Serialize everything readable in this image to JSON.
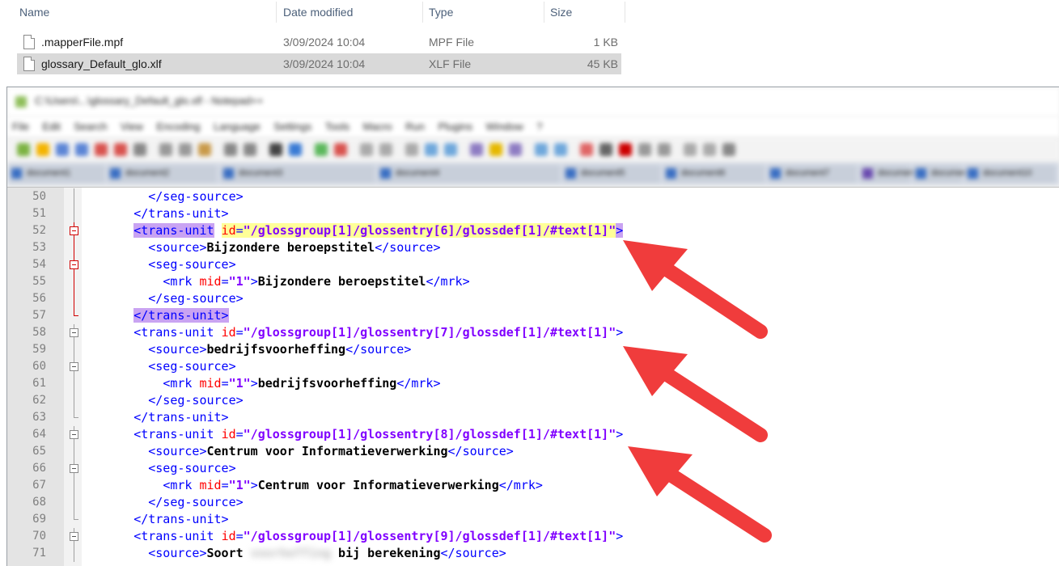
{
  "explorer": {
    "columns": [
      "Name",
      "Date modified",
      "Type",
      "Size"
    ],
    "files": [
      {
        "name": ".mapperFile.mpf",
        "date": "3/09/2024 10:04",
        "type": "MPF File",
        "size": "1 KB",
        "selected": false
      },
      {
        "name": "glossary_Default_glo.xlf",
        "date": "3/09/2024 10:04",
        "type": "XLF File",
        "size": "45 KB",
        "selected": true
      }
    ]
  },
  "notepad": {
    "title": "C:\\Users\\...\\glossary_Default_glo.xlf - Notepad++",
    "menu": [
      "File",
      "Edit",
      "Search",
      "View",
      "Encoding",
      "Language",
      "Settings",
      "Tools",
      "Macro",
      "Run",
      "Plugins",
      "Window",
      "?"
    ],
    "tabs": [
      "document1",
      "document2",
      "document3",
      "document4",
      "document5",
      "document6",
      "document7",
      "document8",
      "document9",
      "document10"
    ]
  },
  "editor": {
    "lines": [
      {
        "num": "50",
        "pre": "        ",
        "parts": [
          [
            "tag",
            "</seg-source>"
          ]
        ]
      },
      {
        "num": "51",
        "pre": "      ",
        "parts": [
          [
            "tag",
            "</trans-unit>"
          ]
        ]
      },
      {
        "num": "52",
        "pre": "      ",
        "parts": [
          [
            "tag hl-tag",
            "<trans-unit"
          ],
          [
            "plain",
            " "
          ],
          [
            "attr hl-attr",
            "id"
          ],
          [
            "tag hl-attr",
            "="
          ],
          [
            "val hl-attr",
            "\"/glossgroup[1]/glossentry[6]/glossdef[1]/#text[1]\""
          ],
          [
            "tag hl-tag",
            ">"
          ]
        ]
      },
      {
        "num": "53",
        "pre": "        ",
        "parts": [
          [
            "tag",
            "<source>"
          ],
          [
            "txt",
            "Bijzondere beroepstitel"
          ],
          [
            "tag",
            "</source>"
          ]
        ]
      },
      {
        "num": "54",
        "pre": "        ",
        "parts": [
          [
            "tag",
            "<seg-source>"
          ]
        ]
      },
      {
        "num": "55",
        "pre": "          ",
        "parts": [
          [
            "tag",
            "<mrk "
          ],
          [
            "attr",
            "mid"
          ],
          [
            "tag",
            "="
          ],
          [
            "val",
            "\"1\""
          ],
          [
            "tag",
            ">"
          ],
          [
            "txt",
            "Bijzondere beroepstitel"
          ],
          [
            "tag",
            "</mrk>"
          ]
        ]
      },
      {
        "num": "56",
        "pre": "        ",
        "parts": [
          [
            "tag",
            "</seg-source>"
          ]
        ]
      },
      {
        "num": "57",
        "pre": "      ",
        "parts": [
          [
            "tag hl-tag",
            "</trans-unit>"
          ]
        ]
      },
      {
        "num": "58",
        "pre": "      ",
        "parts": [
          [
            "tag",
            "<trans-unit "
          ],
          [
            "attr",
            "id"
          ],
          [
            "tag",
            "="
          ],
          [
            "val",
            "\"/glossgroup[1]/glossentry[7]/glossdef[1]/#text[1]\""
          ],
          [
            "tag",
            ">"
          ]
        ]
      },
      {
        "num": "59",
        "pre": "        ",
        "parts": [
          [
            "tag",
            "<source>"
          ],
          [
            "txt",
            "bedrijfsvoorheffing"
          ],
          [
            "tag",
            "</source>"
          ]
        ]
      },
      {
        "num": "60",
        "pre": "        ",
        "parts": [
          [
            "tag",
            "<seg-source>"
          ]
        ]
      },
      {
        "num": "61",
        "pre": "          ",
        "parts": [
          [
            "tag",
            "<mrk "
          ],
          [
            "attr",
            "mid"
          ],
          [
            "tag",
            "="
          ],
          [
            "val",
            "\"1\""
          ],
          [
            "tag",
            ">"
          ],
          [
            "txt",
            "bedrijfsvoorheffing"
          ],
          [
            "tag",
            "</mrk>"
          ]
        ]
      },
      {
        "num": "62",
        "pre": "        ",
        "parts": [
          [
            "tag",
            "</seg-source>"
          ]
        ]
      },
      {
        "num": "63",
        "pre": "      ",
        "parts": [
          [
            "tag",
            "</trans-unit>"
          ]
        ]
      },
      {
        "num": "64",
        "pre": "      ",
        "parts": [
          [
            "tag",
            "<trans-unit "
          ],
          [
            "attr",
            "id"
          ],
          [
            "tag",
            "="
          ],
          [
            "val",
            "\"/glossgroup[1]/glossentry[8]/glossdef[1]/#text[1]\""
          ],
          [
            "tag",
            ">"
          ]
        ]
      },
      {
        "num": "65",
        "pre": "        ",
        "parts": [
          [
            "tag",
            "<source>"
          ],
          [
            "txt",
            "Centrum voor Informatieverwerking"
          ],
          [
            "tag",
            "</source>"
          ]
        ]
      },
      {
        "num": "66",
        "pre": "        ",
        "parts": [
          [
            "tag",
            "<seg-source>"
          ]
        ]
      },
      {
        "num": "67",
        "pre": "          ",
        "parts": [
          [
            "tag",
            "<mrk "
          ],
          [
            "attr",
            "mid"
          ],
          [
            "tag",
            "="
          ],
          [
            "val",
            "\"1\""
          ],
          [
            "tag",
            ">"
          ],
          [
            "txt",
            "Centrum voor Informatieverwerking"
          ],
          [
            "tag",
            "</mrk>"
          ]
        ]
      },
      {
        "num": "68",
        "pre": "        ",
        "parts": [
          [
            "tag",
            "</seg-source>"
          ]
        ]
      },
      {
        "num": "69",
        "pre": "      ",
        "parts": [
          [
            "tag",
            "</trans-unit>"
          ]
        ]
      },
      {
        "num": "70",
        "pre": "      ",
        "parts": [
          [
            "tag",
            "<trans-unit "
          ],
          [
            "attr",
            "id"
          ],
          [
            "tag",
            "="
          ],
          [
            "val",
            "\"/glossgroup[1]/glossentry[9]/glossdef[1]/#text[1]\""
          ],
          [
            "tag",
            ">"
          ]
        ]
      },
      {
        "num": "71",
        "pre": "        ",
        "parts": [
          [
            "tag",
            "<source>"
          ],
          [
            "txt",
            "Soort "
          ],
          [
            "txt blurred-word",
            "voorheffing"
          ],
          [
            "txt",
            " bij berekening"
          ],
          [
            "tag",
            "</source>"
          ]
        ]
      }
    ],
    "fold_markers": {
      "50": "line",
      "51": "line",
      "52": "box-active",
      "53": "line-red",
      "54": "box-active",
      "55": "line-red",
      "56": "line-red",
      "57": "end-red",
      "58": "box",
      "59": "line",
      "60": "box",
      "61": "line",
      "62": "line",
      "63": "end",
      "64": "box",
      "65": "line",
      "66": "box",
      "67": "line",
      "68": "line",
      "69": "end",
      "70": "box",
      "71": "line"
    }
  },
  "colors": {
    "tag": "#0000ff",
    "attr": "#ff0000",
    "value": "#8000ff",
    "highlight_tag": "#c9a3f2",
    "highlight_attr": "#ffff99",
    "arrow": "#f03c3c"
  }
}
